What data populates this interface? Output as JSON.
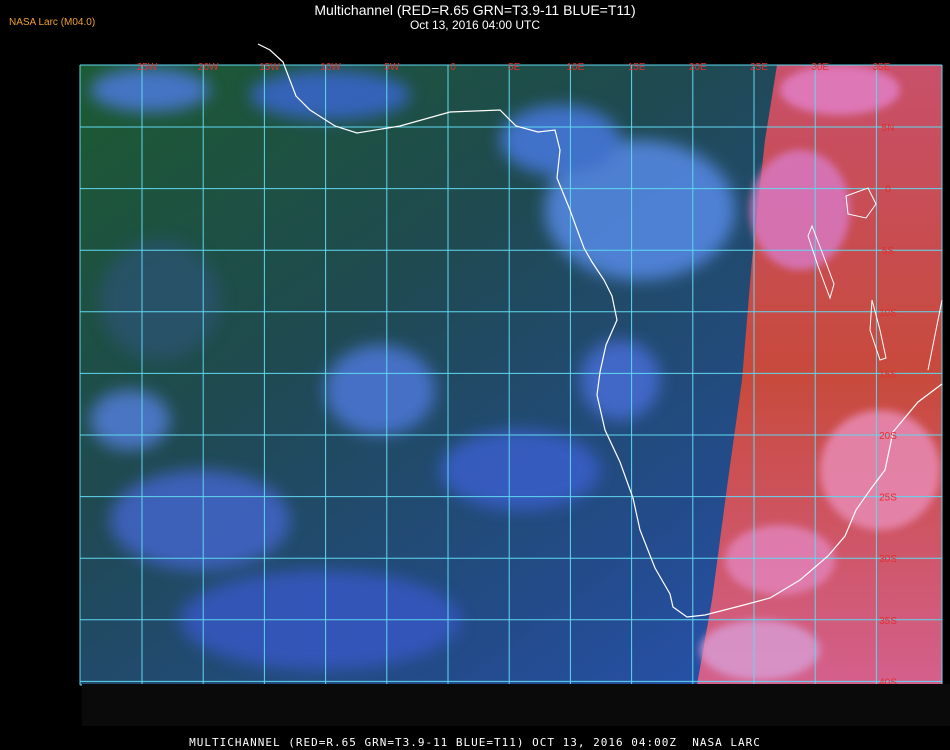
{
  "header": {
    "source_tag": "NASA Larc (M04.0)",
    "title": "Multichannel (RED=R.65 GRN=T3.9-11 BLUE=T11)",
    "subtitle": "Oct 13, 2016 04:00 UTC"
  },
  "footer": {
    "caption": "MULTICHANNEL (RED=R.65 GRN=T3.9-11 BLUE=T11) OCT 13, 2016 04:00Z  NASA LARC"
  },
  "map": {
    "colors": {
      "grid": "#60d8f0",
      "coastline": "#ffffff",
      "labels": "#e03030",
      "ocean_dark": "#1f4a50",
      "ocean_green": "#1c5a30",
      "cloud_blue": "#3f6fe0",
      "day_red": "#d0443a",
      "day_pink": "#e070b0"
    },
    "longitude_labels": [
      "25W",
      "20W",
      "15W",
      "10W",
      "5W",
      "0",
      "5E",
      "10E",
      "15E",
      "20E",
      "25E",
      "30E",
      "35E"
    ],
    "latitude_labels": [
      "5N",
      "0",
      "5S",
      "10S",
      "15S",
      "20S",
      "25S",
      "30S",
      "35S",
      "40S"
    ]
  }
}
